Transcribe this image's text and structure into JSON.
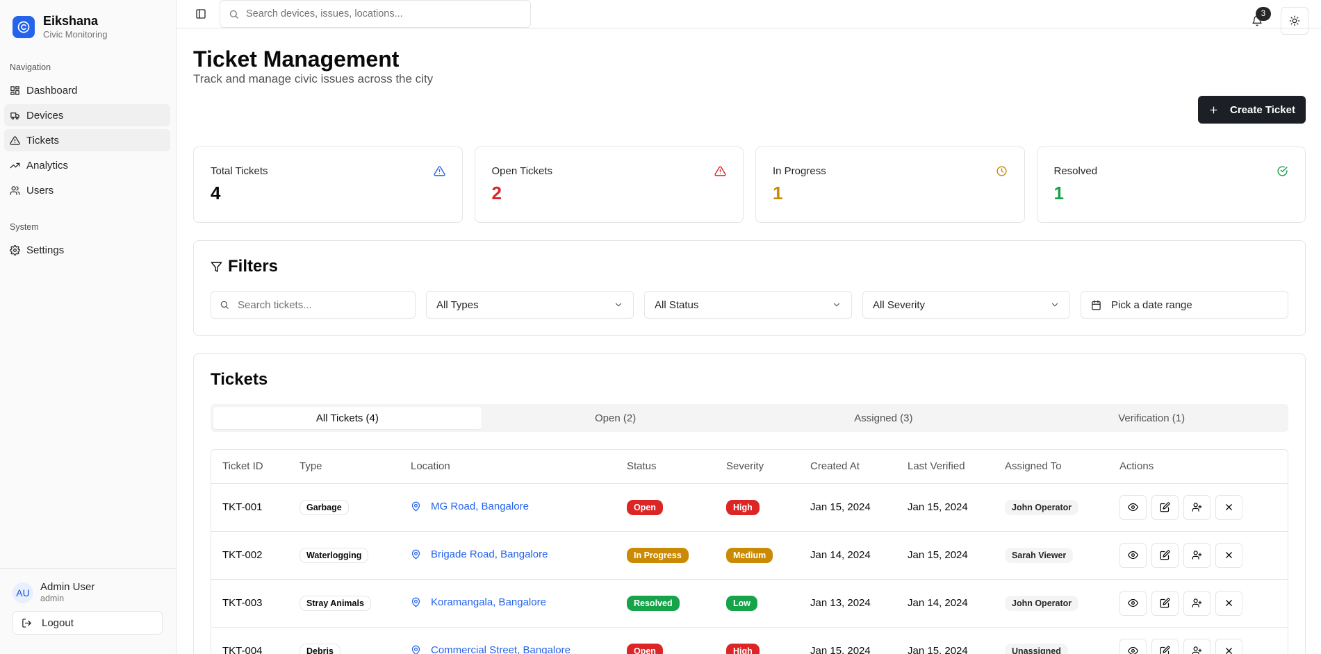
{
  "brand": {
    "name": "Eikshana",
    "subtitle": "Civic Monitoring"
  },
  "sidebar": {
    "nav_label": "Navigation",
    "items": [
      {
        "label": "Dashboard",
        "icon": "grid-icon"
      },
      {
        "label": "Devices",
        "icon": "truck-icon"
      },
      {
        "label": "Tickets",
        "icon": "warning-triangle-icon"
      },
      {
        "label": "Analytics",
        "icon": "trending-up-icon"
      },
      {
        "label": "Users",
        "icon": "users-icon"
      }
    ],
    "system_label": "System",
    "system_items": [
      {
        "label": "Settings",
        "icon": "gear-icon"
      }
    ],
    "user": {
      "initials": "AU",
      "name": "Admin User",
      "role": "admin"
    },
    "logout_label": "Logout"
  },
  "topbar": {
    "search_placeholder": "Search devices, issues, locations...",
    "notification_count": "3"
  },
  "page": {
    "title": "Ticket Management",
    "subtitle": "Track and manage civic issues across the city",
    "create_label": "Create Ticket"
  },
  "stats": [
    {
      "label": "Total Tickets",
      "value": "4",
      "color": "#0a0a0a",
      "icon_color": "#2563eb"
    },
    {
      "label": "Open Tickets",
      "value": "2",
      "color": "#dc2626",
      "icon_color": "#dc2626"
    },
    {
      "label": "In Progress",
      "value": "1",
      "color": "#ca8a04",
      "icon_color": "#ca8a04"
    },
    {
      "label": "Resolved",
      "value": "1",
      "color": "#16a34a",
      "icon_color": "#16a34a"
    }
  ],
  "filters": {
    "title": "Filters",
    "search_placeholder": "Search tickets...",
    "type": "All Types",
    "status": "All Status",
    "severity": "All Severity",
    "date": "Pick a date range"
  },
  "tickets": {
    "title": "Tickets",
    "tabs": [
      "All Tickets (4)",
      "Open (2)",
      "Assigned (3)",
      "Verification (1)"
    ],
    "columns": [
      "Ticket ID",
      "Type",
      "Location",
      "Status",
      "Severity",
      "Created At",
      "Last Verified",
      "Assigned To",
      "Actions"
    ],
    "rows": [
      {
        "id": "TKT-001",
        "type": "Garbage",
        "location": "MG Road, Bangalore",
        "status": "Open",
        "status_color": "#dc2626",
        "severity": "High",
        "severity_color": "#dc2626",
        "created": "Jan 15, 2024",
        "verified": "Jan 15, 2024",
        "assigned": "John Operator"
      },
      {
        "id": "TKT-002",
        "type": "Waterlogging",
        "location": "Brigade Road, Bangalore",
        "status": "In Progress",
        "status_color": "#ca8a04",
        "severity": "Medium",
        "severity_color": "#ca8a04",
        "created": "Jan 14, 2024",
        "verified": "Jan 15, 2024",
        "assigned": "Sarah Viewer"
      },
      {
        "id": "TKT-003",
        "type": "Stray Animals",
        "location": "Koramangala, Bangalore",
        "status": "Resolved",
        "status_color": "#16a34a",
        "severity": "Low",
        "severity_color": "#16a34a",
        "created": "Jan 13, 2024",
        "verified": "Jan 14, 2024",
        "assigned": "John Operator"
      },
      {
        "id": "TKT-004",
        "type": "Debris",
        "location": "Commercial Street, Bangalore",
        "status": "Open",
        "status_color": "#dc2626",
        "severity": "High",
        "severity_color": "#dc2626",
        "created": "Jan 15, 2024",
        "verified": "Jan 15, 2024",
        "assigned": "Unassigned"
      }
    ]
  }
}
